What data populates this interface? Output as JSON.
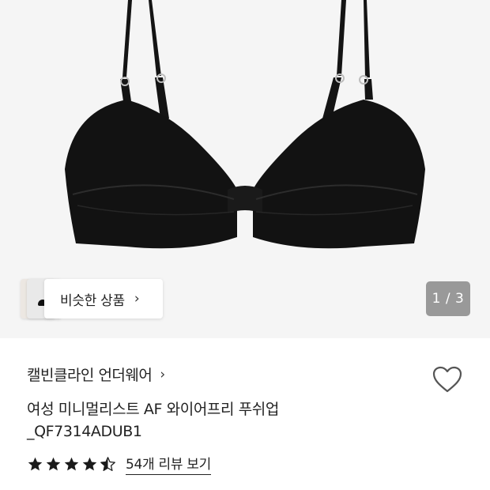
{
  "similar": {
    "label": "비슷한 상품",
    "arrow": "›"
  },
  "gallery": {
    "counter": "1 / 3",
    "current": 1,
    "total": 3
  },
  "brand": {
    "name": "캘빈클라인 언더웨어",
    "arrow": "›"
  },
  "product": {
    "title_line1": "여성 미니멀리스트 AF 와이어프리 푸쉬업",
    "title_line2": "_QF7314ADUB1"
  },
  "rating": {
    "value": 4.5,
    "max": 5,
    "review_link": "54개 리뷰 보기"
  },
  "colors": {
    "star": "#1a1a1a",
    "counter_bg": "#999999",
    "product": "#111111"
  },
  "icons": {
    "wishlist": "heart-outline-icon",
    "star": "star-icon"
  }
}
